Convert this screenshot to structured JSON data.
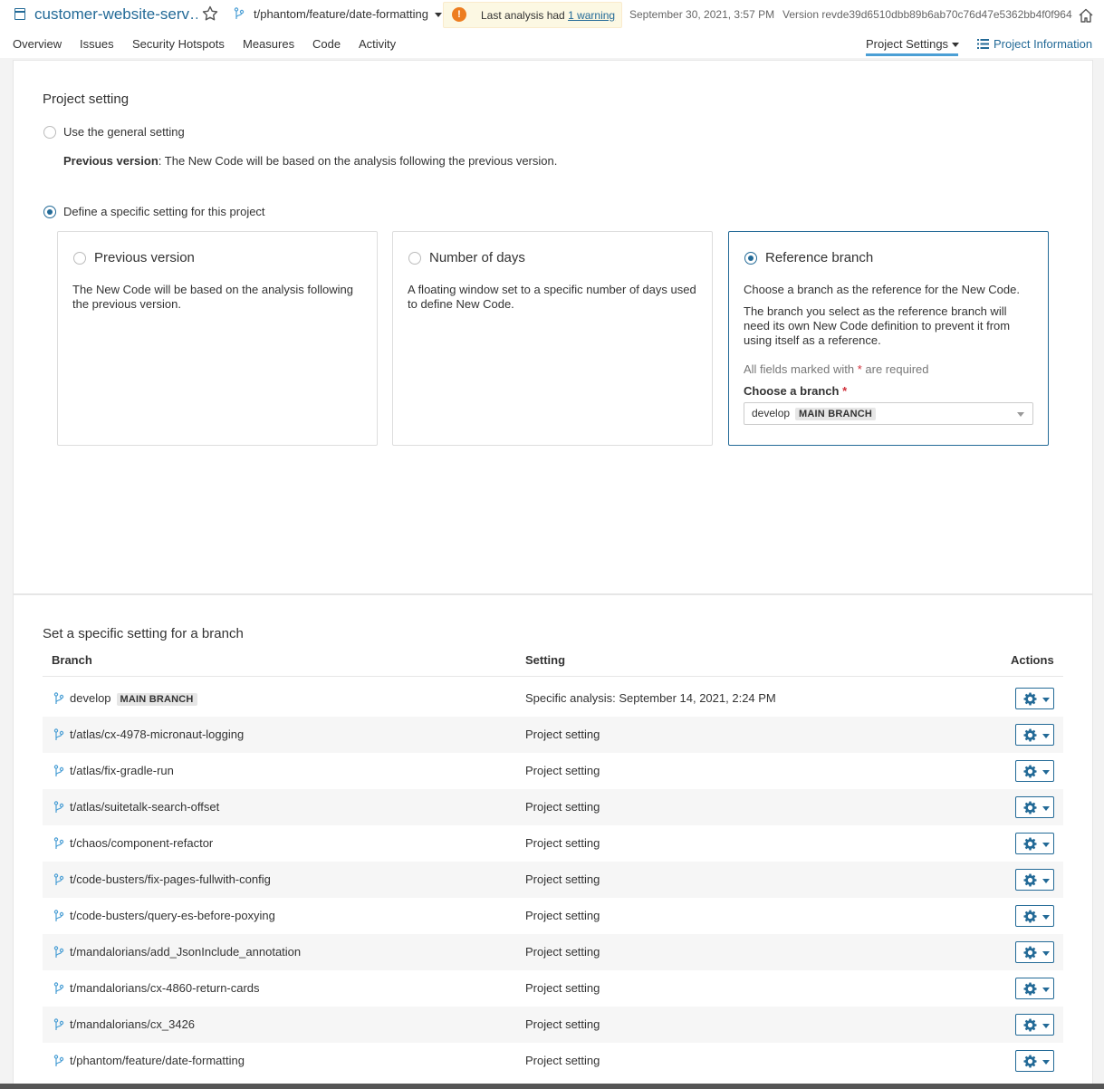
{
  "header": {
    "project_name": "customer-website-serv…",
    "branch": "t/phantom/feature/date-formatting",
    "warning_prefix": "Last analysis had ",
    "warning_link": "1 warning",
    "date": "September 30, 2021, 3:57 PM",
    "version": "Version revde39d6510dbb89b6ab70c76d47e5362bb4f0f964"
  },
  "nav": {
    "overview": "Overview",
    "issues": "Issues",
    "security_hotspots": "Security Hotspots",
    "measures": "Measures",
    "code": "Code",
    "activity": "Activity",
    "project_settings": "Project Settings",
    "project_information": "Project Information"
  },
  "project_setting": {
    "heading": "Project setting",
    "general_option": "Use the general setting",
    "general_desc_bold": "Previous version",
    "general_desc": ": The New Code will be based on the analysis following the previous version.",
    "specific_option": "Define a specific setting for this project",
    "cards": [
      {
        "title": "Previous version",
        "text": "The New Code will be based on the analysis following the previous version.",
        "selected": false
      },
      {
        "title": "Number of days",
        "text": "A floating window set to a specific number of days used to define New Code.",
        "selected": false
      },
      {
        "title": "Reference branch",
        "text": "Choose a branch as the reference for the New Code.",
        "text2": "The branch you select as the reference branch will need its own New Code definition to prevent it from using itself as a reference.",
        "selected": true
      }
    ],
    "required_note_prefix": "All fields marked with ",
    "required_note_star": "*",
    "required_note_suffix": " are required",
    "choose_label": "Choose a branch",
    "choose_star": "*",
    "selected_branch": "develop",
    "selected_badge": "MAIN BRANCH"
  },
  "branch_table": {
    "heading": "Set a specific setting for a branch",
    "columns": {
      "branch": "Branch",
      "setting": "Setting",
      "actions": "Actions"
    },
    "rows": [
      {
        "name": "develop",
        "badge": "MAIN BRANCH",
        "setting": "Specific analysis: September 14, 2021, 2:24 PM"
      },
      {
        "name": "t/atlas/cx-4978-micronaut-logging",
        "setting": "Project setting"
      },
      {
        "name": "t/atlas/fix-gradle-run",
        "setting": "Project setting"
      },
      {
        "name": "t/atlas/suitetalk-search-offset",
        "setting": "Project setting"
      },
      {
        "name": "t/chaos/component-refactor",
        "setting": "Project setting"
      },
      {
        "name": "t/code-busters/fix-pages-fullwith-config",
        "setting": "Project setting"
      },
      {
        "name": "t/code-busters/query-es-before-poxying",
        "setting": "Project setting"
      },
      {
        "name": "t/mandalorians/add_JsonInclude_annotation",
        "setting": "Project setting"
      },
      {
        "name": "t/mandalorians/cx-4860-return-cards",
        "setting": "Project setting"
      },
      {
        "name": "t/mandalorians/cx_3426",
        "setting": "Project setting"
      },
      {
        "name": "t/phantom/feature/date-formatting",
        "setting": "Project setting"
      }
    ]
  },
  "colors": {
    "accent": "#236a97",
    "warning": "#ed7d20",
    "active_tab": "#4b9fd5"
  }
}
